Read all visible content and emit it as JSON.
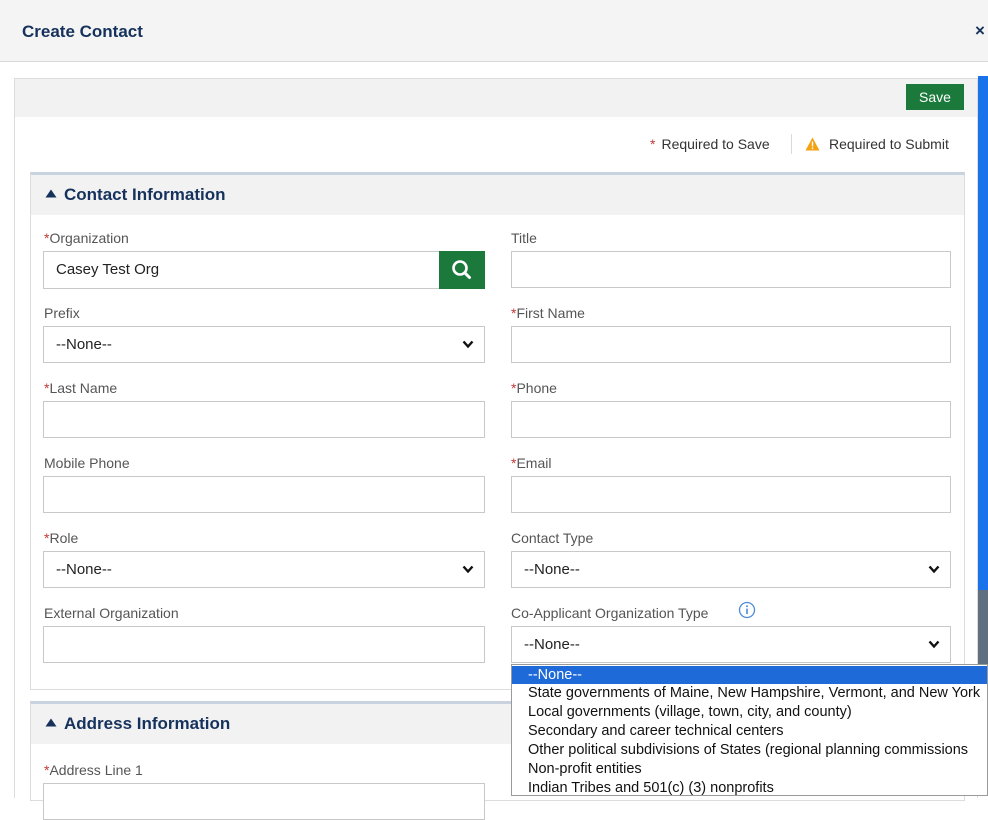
{
  "modal": {
    "title": "Create Contact",
    "close_label": "×"
  },
  "toolbar": {
    "save_label": "Save"
  },
  "legend": {
    "required_save": "Required to Save",
    "required_submit": "Required to Submit",
    "required_marker": "*"
  },
  "contact_section": {
    "title": "Contact Information",
    "fields": {
      "organization": {
        "label": "Organization",
        "required": "*",
        "value": "Casey Test Org"
      },
      "title": {
        "label": "Title",
        "value": ""
      },
      "prefix": {
        "label": "Prefix",
        "value": "--None--"
      },
      "first_name": {
        "label": "First Name",
        "required": "*",
        "value": ""
      },
      "last_name": {
        "label": "Last Name",
        "required": "*",
        "value": ""
      },
      "phone": {
        "label": "Phone",
        "required": "*",
        "value": ""
      },
      "mobile_phone": {
        "label": "Mobile Phone",
        "value": ""
      },
      "email": {
        "label": "Email",
        "required": "*",
        "value": ""
      },
      "role": {
        "label": "Role",
        "required": "*",
        "value": "--None--"
      },
      "contact_type": {
        "label": "Contact Type",
        "value": "--None--"
      },
      "external_org": {
        "label": "External Organization",
        "value": ""
      },
      "co_applicant_type": {
        "label": "Co-Applicant Organization Type",
        "value": "--None--"
      }
    }
  },
  "address_section": {
    "title": "Address Information",
    "address_line1": {
      "label": "Address Line 1",
      "required": "*"
    }
  },
  "dropdown": {
    "options": [
      "--None--",
      "State governments of Maine, New Hampshire, Vermont, and New York",
      "Local governments (village, town, city, and county)",
      "Secondary and career technical centers",
      "Other political subdivisions of States (regional planning commissions",
      "Non-profit entities",
      "Indian Tribes and 501(c) (3) nonprofits"
    ],
    "selected_index": 0
  },
  "colors": {
    "accent_green": "#1b7a3b",
    "header_navy": "#16325c",
    "required_red": "#c23934",
    "warning_orange": "#f4a20f",
    "selection_blue": "#1e6ad9"
  }
}
